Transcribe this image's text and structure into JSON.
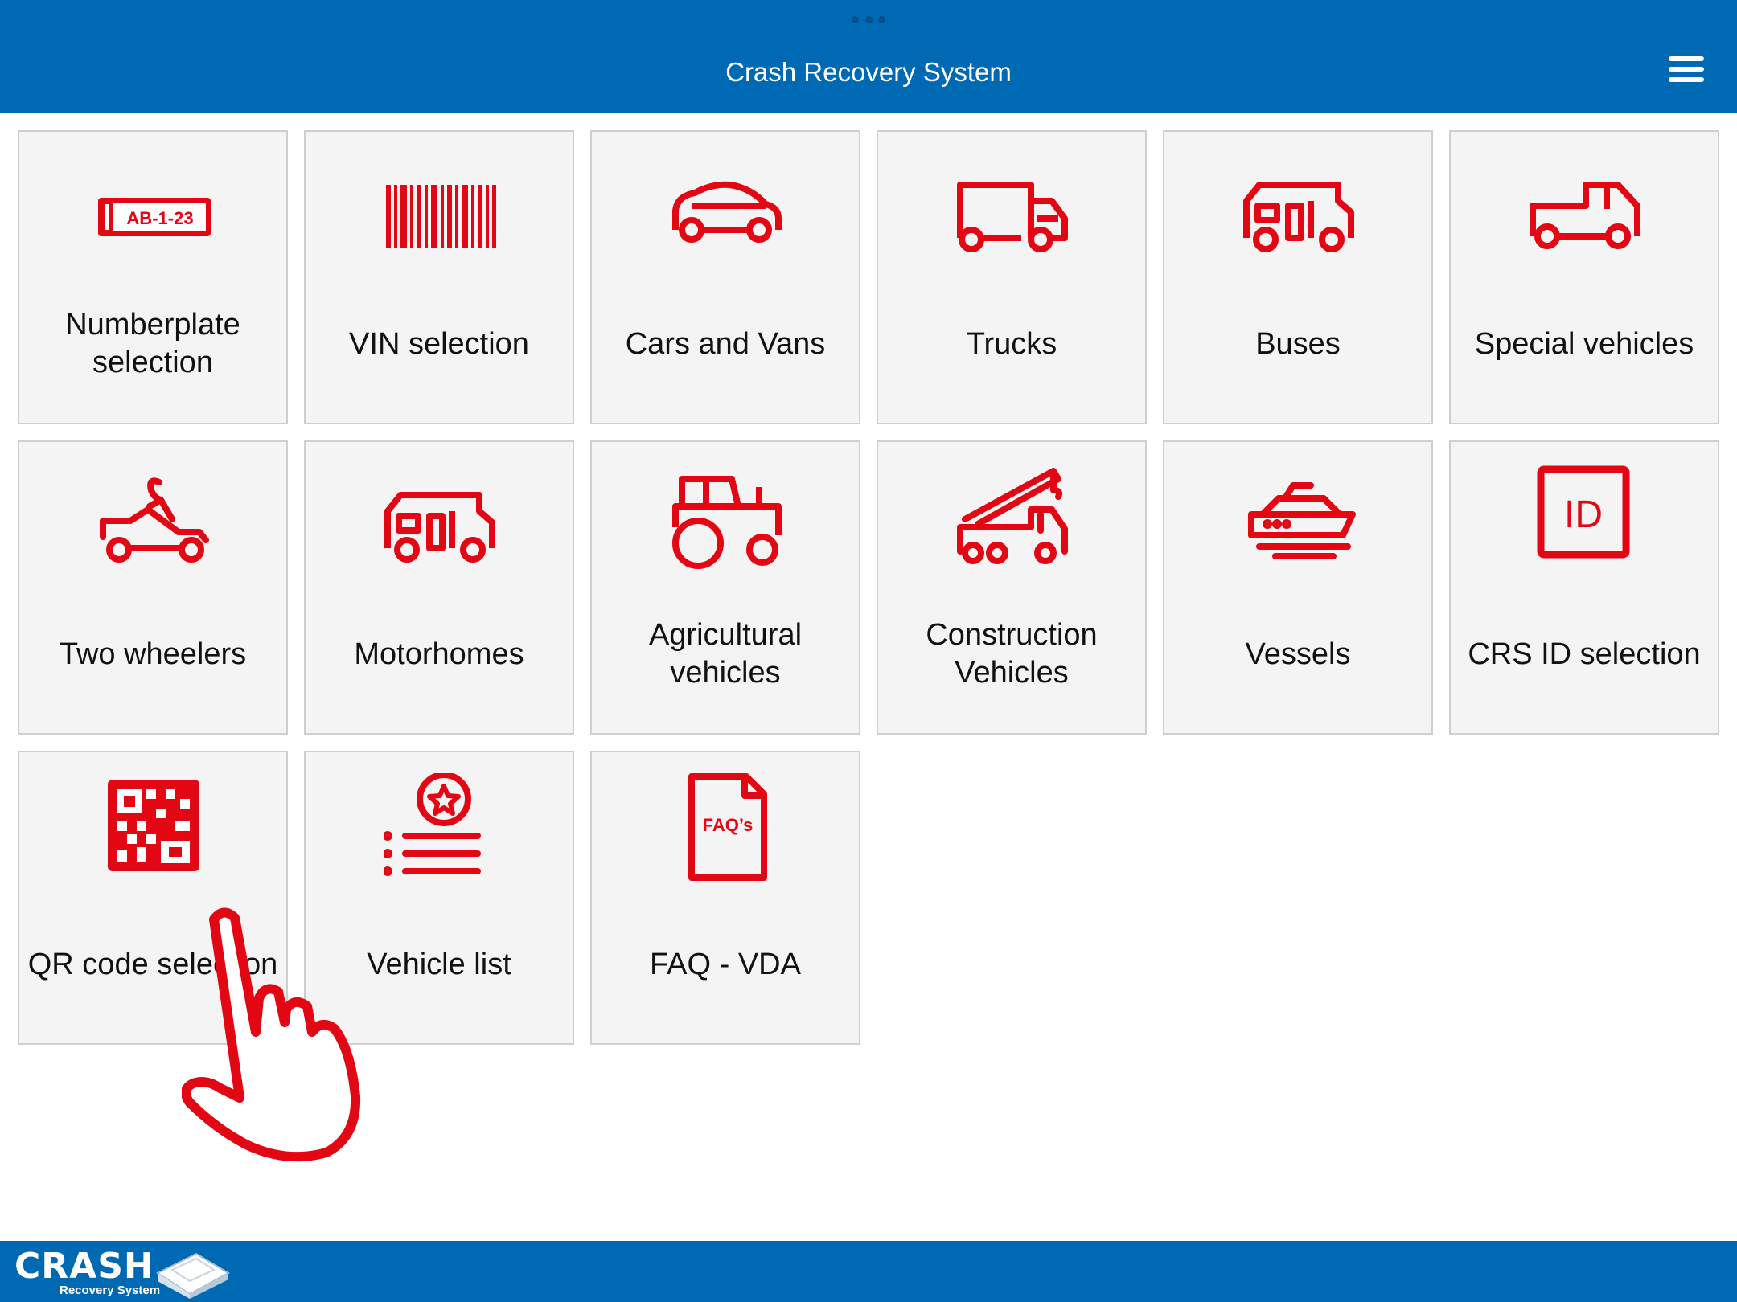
{
  "header": {
    "title": "Crash Recovery System",
    "menu_icon": "hamburger-menu-icon"
  },
  "tiles": [
    {
      "label": "Numberplate selection",
      "icon": "numberplate-icon",
      "plate_text": "AB-1-23"
    },
    {
      "label": "VIN selection",
      "icon": "barcode-icon"
    },
    {
      "label": "Cars and Vans",
      "icon": "car-icon"
    },
    {
      "label": "Trucks",
      "icon": "truck-icon"
    },
    {
      "label": "Buses",
      "icon": "bus-icon"
    },
    {
      "label": "Special vehicles",
      "icon": "pickup-truck-icon"
    },
    {
      "label": "Two wheelers",
      "icon": "motorcycle-icon"
    },
    {
      "label": "Motorhomes",
      "icon": "motorhome-icon"
    },
    {
      "label": "Agricultural vehicles",
      "icon": "tractor-icon"
    },
    {
      "label": "Construction Vehicles",
      "icon": "crane-truck-icon"
    },
    {
      "label": "Vessels",
      "icon": "boat-icon"
    },
    {
      "label": "CRS ID selection",
      "icon": "id-icon",
      "id_text": "ID"
    },
    {
      "label": "QR code selection",
      "icon": "qr-code-icon"
    },
    {
      "label": "Vehicle list",
      "icon": "favorite-list-icon"
    },
    {
      "label": "FAQ - VDA",
      "icon": "faq-document-icon",
      "doc_text": "FAQ’s"
    }
  ],
  "overlay": {
    "icon": "pointing-hand-icon"
  },
  "footer": {
    "logo_word": "CRASH",
    "logo_sub": "Recovery System"
  },
  "colors": {
    "header_bg": "#0069b4",
    "icon_red": "#e30613",
    "tile_bg": "#f4f4f4",
    "tile_border": "#cfcfcf"
  }
}
